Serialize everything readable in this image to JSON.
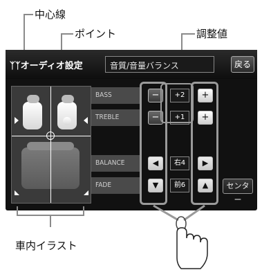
{
  "callouts": {
    "center_line": "中心線",
    "point": "ポイント",
    "adjust_value": "調整値",
    "car_illustration": "車内イラスト"
  },
  "title": {
    "icon_text": "ᛉᛉ",
    "text": "オーディオ設定",
    "field": "音質/音量バランス",
    "back": "戻る"
  },
  "rows": {
    "bass": {
      "label": "BASS",
      "minus": "−",
      "value": "+2",
      "plus": "+"
    },
    "treble": {
      "label": "TREBLE",
      "minus": "−",
      "value": "+1",
      "plus": "+"
    },
    "balance": {
      "label": "BALANCE",
      "left": "◀",
      "value": "右4",
      "right": "▶"
    },
    "fade": {
      "label": "FADE",
      "down": "▼",
      "value": "前6",
      "up": "▲"
    }
  },
  "center_button": "センター"
}
